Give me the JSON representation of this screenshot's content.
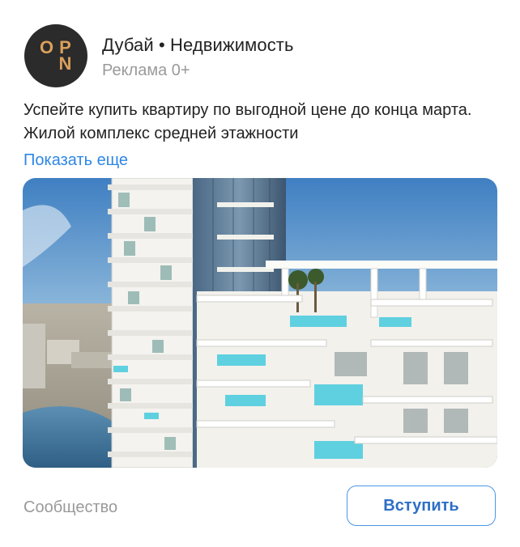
{
  "ad": {
    "logo_letters": [
      "O",
      "P",
      "",
      "N"
    ],
    "title": "Дубай • Недвижимость",
    "subtitle": "Реклама 0+",
    "body": "Успейте купить квартиру по выгодной цене до конца марта. Жилой комплекс средней этажности",
    "more_link": "Показать еще",
    "footer_label": "Сообщество",
    "join_button": "Вступить"
  },
  "colors": {
    "logo_bg": "#2b2b2b",
    "logo_letters": "#d9a05b",
    "link": "#2e87e6",
    "button_border": "#4a96e8",
    "button_text": "#2e6fc6",
    "muted_text": "#9a9a9a"
  },
  "icons": {
    "avatar": "opn-logo-icon",
    "photo": "residential-tower-photo"
  }
}
